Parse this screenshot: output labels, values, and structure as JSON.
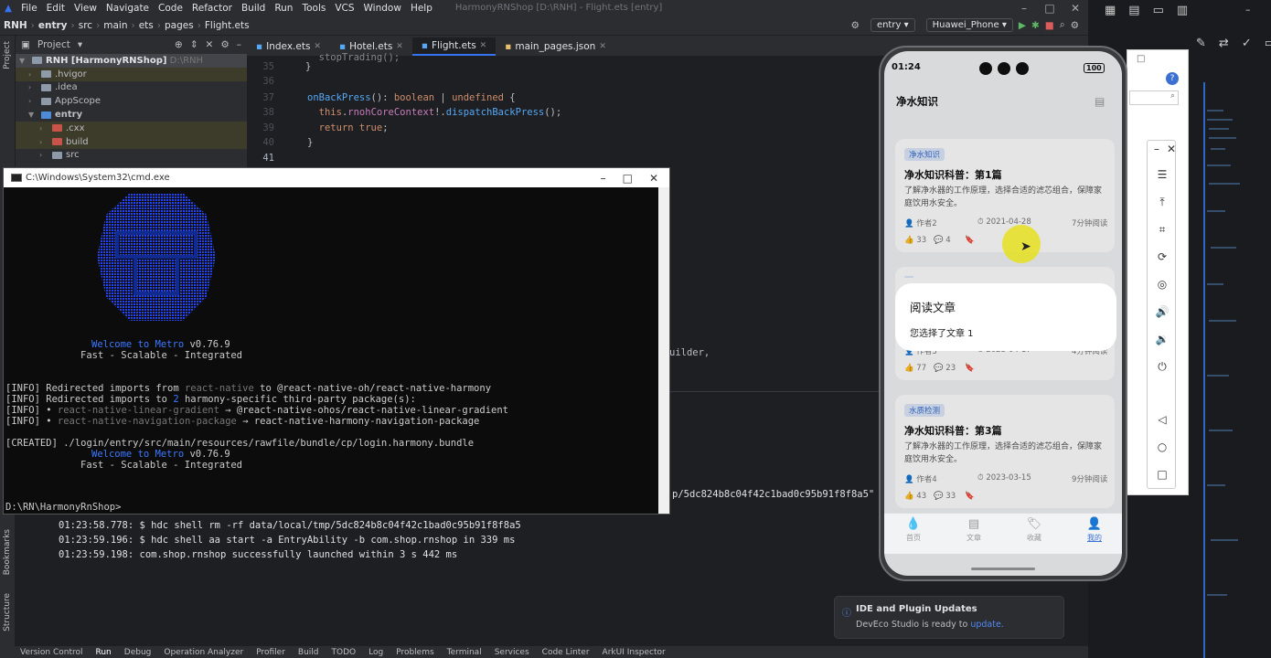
{
  "menubar": {
    "items": [
      "File",
      "Edit",
      "View",
      "Navigate",
      "Code",
      "Refactor",
      "Build",
      "Run",
      "Tools",
      "VCS",
      "Window",
      "Help"
    ],
    "window_title": "HarmonyRNShop [D:\\RNH] - Flight.ets [entry]"
  },
  "navbar": {
    "crumbs": [
      "RNH",
      "entry",
      "src",
      "main",
      "ets",
      "pages",
      "Flight.ets"
    ],
    "run_config": "entry",
    "device": "Huawei_Phone"
  },
  "project": {
    "header": "Project",
    "tree": [
      {
        "label": "RNH [HarmonyRNShop]",
        "suffix": "D:\\RNH",
        "depth": 0,
        "open": true
      },
      {
        "label": ".hvigor",
        "depth": 1
      },
      {
        "label": ".idea",
        "depth": 1
      },
      {
        "label": "AppScope",
        "depth": 1
      },
      {
        "label": "entry",
        "depth": 1,
        "open": true
      },
      {
        "label": ".cxx",
        "depth": 2
      },
      {
        "label": "build",
        "depth": 2
      },
      {
        "label": "src",
        "depth": 2
      }
    ]
  },
  "sidebar": {
    "project": "Project",
    "bookmarks": "Bookmarks",
    "structure": "Structure"
  },
  "editor_tabs": [
    "Index.ets",
    "Hotel.ets",
    "Flight.ets",
    "main_pages.json"
  ],
  "editor": {
    "lines": [
      {
        "n": "35",
        "text": "  stopTrading();"
      },
      {
        "n": "36",
        "text": "}"
      },
      {
        "n": "37",
        "text": ""
      },
      {
        "n": "38",
        "text": "onBackPress(): boolean | undefined {"
      },
      {
        "n": "39",
        "text": "  this.rnohCoreContext!.dispatchBackPress();"
      },
      {
        "n": "40",
        "text": "  return true;"
      },
      {
        "n": "41",
        "text": "}"
      }
    ],
    "fragment_builder": "uilder,",
    "fragment_path": "p/5dc824b8c04f42c1bad0c95b91f8f8a5\" in"
  },
  "cmd": {
    "title": "C:\\Windows\\System32\\cmd.exe",
    "lines": [
      "Welcome to Metro v0.76.9",
      "Fast - Scalable - Integrated",
      "[INFO] Redirected imports from react-native to @react-native-oh/react-native-harmony",
      "[INFO] Redirected imports to 2 harmony-specific third-party package(s):",
      "[INFO] • react-native-linear-gradient → @react-native-ohos/react-native-linear-gradient",
      "[INFO] • react-native-navigation-package → react-native-harmony-navigation-package",
      "[CREATED] ./login/entry/src/main/resources/rawfile/bundle/cp/login.harmony.bundle",
      "Welcome to Metro v0.76.9",
      "Fast - Scalable - Integrated",
      "D:\\RN\\HarmonyRnShop>"
    ]
  },
  "run_log": [
    "01:23:58.778: $ hdc shell rm -rf data/local/tmp/5dc824b8c04f42c1bad0c95b91f8f8a5",
    "01:23:59.196: $ hdc shell aa start -a EntryAbility -b com.shop.rnshop in 339 ms",
    "01:23:59.198: com.shop.rnshop successfully launched within 3 s 442 ms"
  ],
  "statusbar": [
    "Version Control",
    "Run",
    "Debug",
    "Operation Analyzer",
    "Profiler",
    "Build",
    "TODO",
    "Log",
    "Problems",
    "Terminal",
    "Services",
    "Code Linter",
    "ArkUI Inspector"
  ],
  "phone": {
    "time": "01:24",
    "battery": "100",
    "app_title": "净水知识",
    "cards": [
      {
        "tag": "净水知识",
        "title": "净水知识科普：第1篇",
        "desc": "了解净水器的工作原理，选择合适的滤芯组合，保障家庭饮用水安全。",
        "author": "作者2",
        "date": "2021-04-28",
        "read": "7分钟阅读",
        "likes": "33",
        "comments": "4"
      },
      {
        "tag": "",
        "title": "",
        "desc": "",
        "author": "作者3",
        "date": "2023-04-17",
        "read": "4分钟阅读",
        "likes": "77",
        "comments": "23"
      },
      {
        "tag": "水质检测",
        "title": "净水知识科普：第3篇",
        "desc": "了解净水器的工作原理，选择合适的滤芯组合，保障家庭饮用水安全。",
        "author": "作者4",
        "date": "2023-03-15",
        "read": "9分钟阅读",
        "likes": "43",
        "comments": "33"
      }
    ],
    "dialog": {
      "title": "阅读文章",
      "message": "您选择了文章 1"
    },
    "tabs": [
      "首页",
      "文章",
      "收藏",
      "我的"
    ]
  },
  "notification": {
    "title": "IDE and Plugin Updates",
    "message_prefix": "DevEco Studio is ready to ",
    "link": "update."
  },
  "colors": {
    "accent": "#3574f0",
    "tag_bg": "#dde8fb",
    "tag_fg": "#3b6fd1",
    "cursor_highlight": "#e6e11e"
  }
}
